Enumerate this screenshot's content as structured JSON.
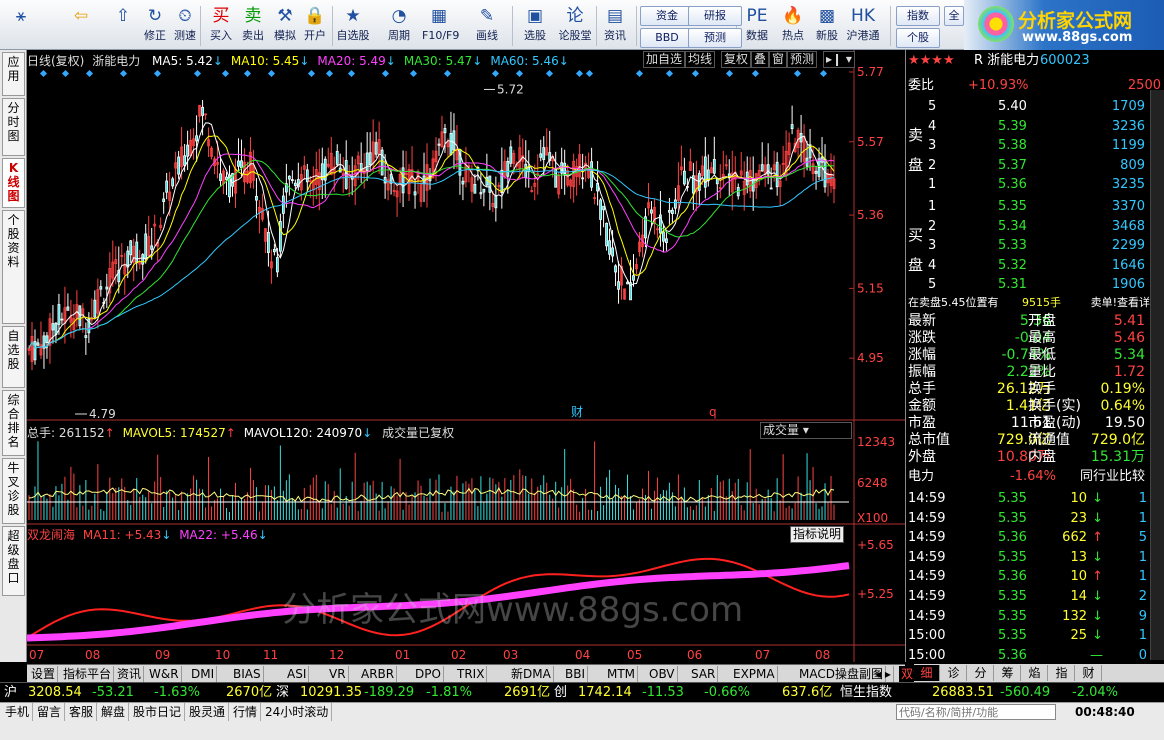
{
  "toolbar": {
    "items": [
      {
        "icon": "⚹",
        "label": ""
      },
      {
        "icon": "⇦",
        "label": ""
      },
      {
        "icon": "⇧",
        "label": ""
      },
      {
        "icon": "↻",
        "label": "修正"
      },
      {
        "icon": "⏲",
        "label": "测速"
      },
      {
        "icon": "买",
        "label": "买入"
      },
      {
        "icon": "卖",
        "label": "卖出"
      },
      {
        "icon": "⚒",
        "label": "模拟"
      },
      {
        "icon": "🔒",
        "label": "开户"
      },
      {
        "icon": "★",
        "label": "自选股"
      },
      {
        "icon": "◔",
        "label": "周期"
      },
      {
        "icon": "▦",
        "label": "F10/F9"
      },
      {
        "icon": "✎",
        "label": "画线"
      },
      {
        "icon": "▣",
        "label": "选股"
      },
      {
        "icon": "论",
        "label": "论股堂"
      },
      {
        "icon": "▤",
        "label": "资讯"
      },
      {
        "icon": "PE",
        "label": "数据"
      },
      {
        "icon": "🔥",
        "label": "热点"
      },
      {
        "icon": "▩",
        "label": "新股"
      },
      {
        "icon": "HK",
        "label": "沪港通"
      }
    ],
    "small": [
      "资金",
      "研报",
      "BBD",
      "预测",
      "指数",
      "个股",
      "全"
    ],
    "logo_title": "分析家公式网",
    "logo_url": "www.88gs.com"
  },
  "sidebar": [
    "应用",
    "分时图",
    "K线图",
    "个股资料",
    "自选股",
    "综合排名",
    "牛叉诊股",
    "超级盘口"
  ],
  "chart": {
    "period": "日线(复权)",
    "name": "浙能电力",
    "ma": [
      {
        "name": "MA5",
        "value": "5.42",
        "color": "#ffffff"
      },
      {
        "name": "MA10",
        "value": "5.45",
        "color": "#ffff00"
      },
      {
        "name": "MA20",
        "value": "5.49",
        "color": "#ff40ff"
      },
      {
        "name": "MA30",
        "value": "5.47",
        "color": "#32e632"
      },
      {
        "name": "MA60",
        "value": "5.46",
        "color": "#32c8ff"
      }
    ],
    "buttons": [
      "加自选",
      "均线",
      "复权",
      "叠",
      "窗",
      "预测"
    ],
    "y_labels": [
      "5.77",
      "5.57",
      "5.36",
      "5.15",
      "4.95"
    ],
    "high": "5.72",
    "low": "4.79",
    "markers": [
      "财",
      "q"
    ],
    "vol_total": "总手: 261152",
    "vol_ma5": "MAVOL5: 174527",
    "vol_ma120": "MAVOL120: 240970",
    "vol_note": "成交量已复权",
    "vol_select": "成交量",
    "vol_y": [
      "12343",
      "6248",
      "X100"
    ],
    "ind_name": "双龙闹海",
    "ind_ma11": "MA11: +5.43",
    "ind_ma22": "MA22: +5.46",
    "ind_btn": "指标说明",
    "ind_y": [
      "+5.65",
      "+5.25"
    ],
    "watermark": "分析家公式网www.88gs.com",
    "months": [
      "07",
      "08",
      "09",
      "10",
      "11",
      "12",
      "01",
      "02",
      "03",
      "04",
      "05",
      "06",
      "07",
      "08"
    ]
  },
  "chart_data": {
    "type": "candlestick",
    "title": "浙能电力 日线(复权)",
    "x_months": [
      "07",
      "08",
      "09",
      "10",
      "11",
      "12",
      "01",
      "02",
      "03",
      "04",
      "05",
      "06",
      "07",
      "08"
    ],
    "y_range": [
      4.79,
      5.77
    ],
    "high": 5.72,
    "low": 4.79,
    "last_close": 5.36,
    "ma": {
      "MA5": 5.42,
      "MA10": 5.45,
      "MA20": 5.49,
      "MA30": 5.47,
      "MA60": 5.46
    },
    "volume": {
      "total": 261152,
      "MAVOL5": 174527,
      "MAVOL120": 240970,
      "y_ticks": [
        12343,
        6248
      ]
    },
    "indicator": {
      "name": "双龙闹海",
      "MA11": 5.43,
      "MA22": 5.46,
      "y_ticks": [
        5.65,
        5.25
      ]
    }
  },
  "quote": {
    "stars": "★★★★",
    "title": "R 浙能电力",
    "code": "600023",
    "webi_label": "委比",
    "webi": "+10.93%",
    "webi_val": "2500",
    "sell_label": "卖盘",
    "buy_label": "买盘",
    "sell": [
      {
        "n": "5",
        "p": "5.40",
        "v": "1709"
      },
      {
        "n": "4",
        "p": "5.39",
        "v": "3236"
      },
      {
        "n": "3",
        "p": "5.38",
        "v": "1199"
      },
      {
        "n": "2",
        "p": "5.37",
        "v": "809"
      },
      {
        "n": "1",
        "p": "5.36",
        "v": "3235"
      }
    ],
    "buy": [
      {
        "n": "1",
        "p": "5.35",
        "v": "3370"
      },
      {
        "n": "2",
        "p": "5.34",
        "v": "3468"
      },
      {
        "n": "3",
        "p": "5.33",
        "v": "2299"
      },
      {
        "n": "4",
        "p": "5.32",
        "v": "1646"
      },
      {
        "n": "5",
        "p": "5.31",
        "v": "1906"
      }
    ],
    "note": "在卖盘5.45位置有",
    "note_vol": "9515手",
    "note_right": "卖单!查看详细",
    "stats": [
      {
        "l": "最新",
        "v": "5.36",
        "c": "gr",
        "l2": "开盘",
        "v2": "5.41",
        "c2": "rd"
      },
      {
        "l": "涨跌",
        "v": "-0.04",
        "c": "gr",
        "l2": "最高",
        "v2": "5.46",
        "c2": "rd"
      },
      {
        "l": "涨幅",
        "v": "-0.74%",
        "c": "gr",
        "l2": "最低",
        "v2": "5.34",
        "c2": "gr"
      },
      {
        "l": "振幅",
        "v": "2.22%",
        "c": "gr",
        "l2": "量比",
        "v2": "1.72",
        "c2": "rd"
      },
      {
        "l": "总手",
        "v": "26.12万",
        "c": "yl",
        "l2": "换手",
        "v2": "0.19%",
        "c2": "yl"
      },
      {
        "l": "金额",
        "v": "1.41亿",
        "c": "yl",
        "l2": "换手(实)",
        "v2": "0.64%",
        "c2": "yl"
      },
      {
        "l": "市盈",
        "v": "11.61",
        "c": "wh",
        "l2": "市盈(动)",
        "v2": "19.50",
        "c2": "wh"
      },
      {
        "l": "总市值",
        "v": "729.0亿",
        "c": "yl",
        "l2": "流通值",
        "v2": "729.0亿",
        "c2": "yl"
      },
      {
        "l": "外盘",
        "v": "10.80万",
        "c": "rd",
        "l2": "内盘",
        "v2": "15.31万",
        "c2": "gr"
      }
    ],
    "sector": "电力",
    "sector_chg": "-1.64%",
    "sector_btn": "同行业比较",
    "ticks": [
      {
        "t": "14:59",
        "p": "5.35",
        "v": "10",
        "d": "↓",
        "x": "1"
      },
      {
        "t": "14:59",
        "p": "5.35",
        "v": "23",
        "d": "↓",
        "x": "1"
      },
      {
        "t": "14:59",
        "p": "5.36",
        "v": "662",
        "d": "↑",
        "x": "5"
      },
      {
        "t": "14:59",
        "p": "5.35",
        "v": "13",
        "d": "↓",
        "x": "1"
      },
      {
        "t": "14:59",
        "p": "5.36",
        "v": "10",
        "d": "↑",
        "x": "1"
      },
      {
        "t": "14:59",
        "p": "5.35",
        "v": "14",
        "d": "↓",
        "x": "2"
      },
      {
        "t": "14:59",
        "p": "5.35",
        "v": "132",
        "d": "↓",
        "x": "9"
      },
      {
        "t": "15:00",
        "p": "5.35",
        "v": "25",
        "d": "↓",
        "x": "1"
      },
      {
        "t": "15:00",
        "p": "5.36",
        "v": "",
        "d": "—",
        "x": "0"
      }
    ]
  },
  "bottabs": [
    "设置",
    "指标平台",
    "资讯",
    "W&R",
    "DMI",
    "BIAS",
    "ASI",
    "VR",
    "ARBR",
    "DPO",
    "TRIX",
    "新DMA",
    "BBI",
    "MTM",
    "OBV",
    "SAR",
    "EXPMA",
    "MACD操盘副图",
    "双龙闹海"
  ],
  "rtabs": [
    "细",
    "诊",
    "分",
    "筹",
    "焰",
    "指",
    "财"
  ],
  "indices": [
    {
      "n": "沪",
      "v": "3208.54",
      "c": "-53.21",
      "p": "-1.63%",
      "a": "2670亿"
    },
    {
      "n": "深",
      "v": "10291.35",
      "c": "-189.29",
      "p": "-1.81%",
      "a": "2691亿"
    },
    {
      "n": "创",
      "v": "1742.14",
      "c": "-11.53",
      "p": "-0.66%",
      "a": "637.6亿"
    },
    {
      "n": "恒生指数",
      "v": "26883.51",
      "c": "-560.49",
      "p": "-2.04%",
      "a": ""
    }
  ],
  "status": [
    "手机",
    "留言",
    "客服",
    "解盘",
    "股市日记",
    "股灵通",
    "行情",
    "24小时滚动"
  ],
  "search_placeholder": "代码/名称/简拼/功能",
  "clock": "00:48:40"
}
